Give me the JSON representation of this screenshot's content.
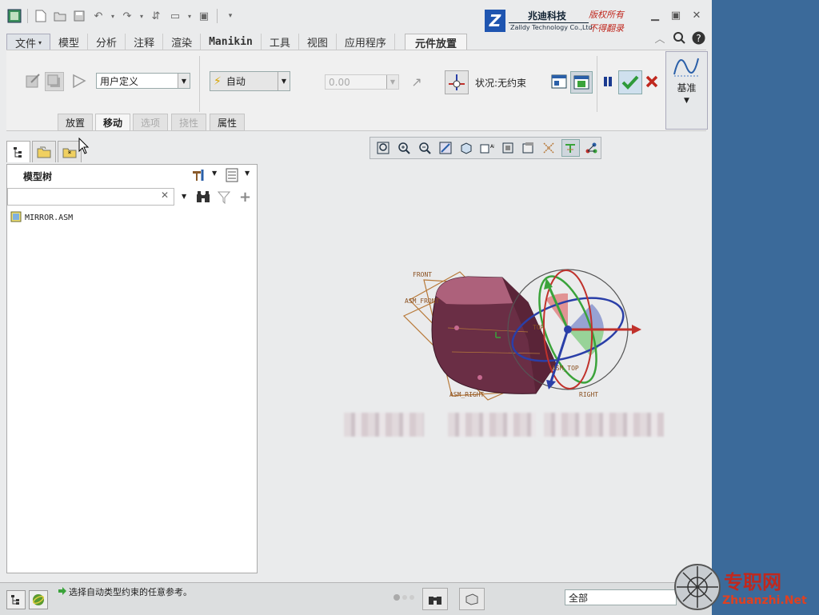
{
  "brand": {
    "logo_letter": "Z",
    "company_cn": "兆迪科技",
    "company_en": "Zalldy Technology Co.,Ltd.",
    "watermark_line1": "版权所有",
    "watermark_line2": "不得翻录"
  },
  "tabs": [
    {
      "label": "文件",
      "has_menu": true
    },
    {
      "label": "模型"
    },
    {
      "label": "分析"
    },
    {
      "label": "注释"
    },
    {
      "label": "渲染"
    },
    {
      "label": "Manikin"
    },
    {
      "label": "工具"
    },
    {
      "label": "视图"
    },
    {
      "label": "应用程序"
    },
    {
      "label": "元件放置",
      "active": true
    }
  ],
  "ribbon": {
    "constraint_dropdown": "用户定义",
    "auto_dropdown": "自动",
    "offset_value": "0.00",
    "status_text": "状况:无约束",
    "datum_label": "基准",
    "subtabs": [
      {
        "label": "放置",
        "enabled": true
      },
      {
        "label": "移动",
        "enabled": true,
        "active": true
      },
      {
        "label": "选项",
        "enabled": false
      },
      {
        "label": "挠性",
        "enabled": false
      },
      {
        "label": "属性",
        "enabled": true
      }
    ]
  },
  "model_tree": {
    "title": "模型树",
    "search_value": "",
    "items": [
      {
        "label": "MIRROR.ASM",
        "icon": "assembly-icon"
      }
    ]
  },
  "viewport": {
    "datum_labels": [
      "FRONT",
      "ASM_FRONT",
      "TOP",
      "ASM_TOP",
      "ASM_RIGHT",
      "RIGHT"
    ]
  },
  "status_bar": {
    "message": "选择自动类型约束的任意参考。",
    "filter_value": "全部"
  },
  "site_watermark": {
    "cn": "专职网",
    "url": "Zhuanzhi.Net"
  },
  "colors": {
    "desktop": "#3b6a9a",
    "body_maroon": "#6a2e45",
    "datum_orange": "#b87a3a",
    "axis_red": "#c0312b",
    "axis_green": "#3aa33a",
    "axis_blue": "#2a3fa8",
    "accept_green": "#2e9a3a",
    "cancel_red": "#c0281e"
  }
}
